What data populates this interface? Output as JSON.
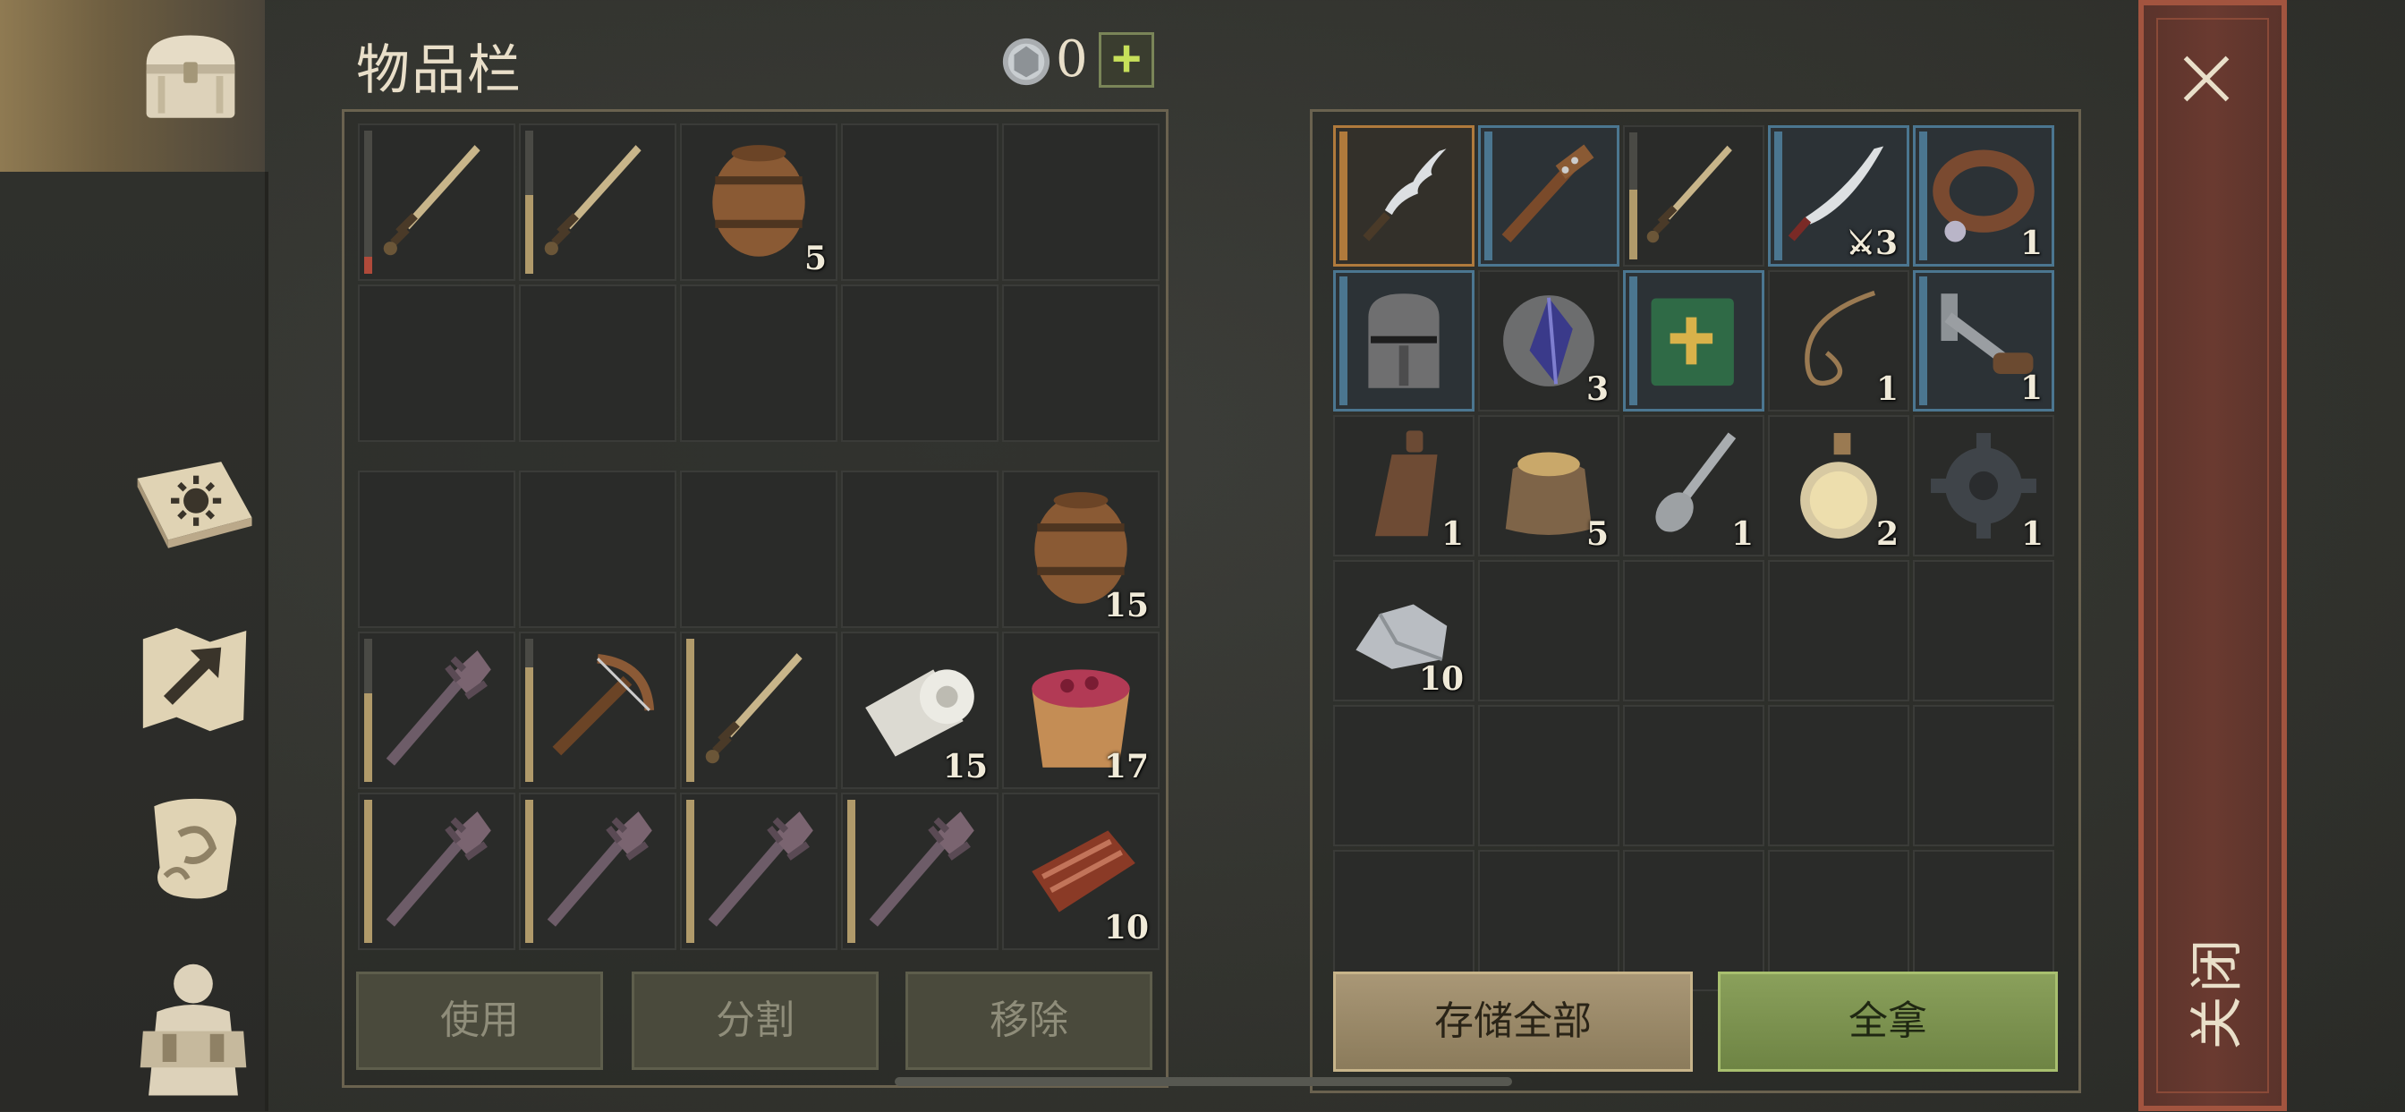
{
  "header": {
    "title": "物品栏",
    "coin_count": "0",
    "add_label": "+"
  },
  "sidebar": {
    "items": [
      {
        "name": "storage-chest",
        "active": true
      },
      {
        "name": "crafting-book",
        "active": false
      },
      {
        "name": "map",
        "active": false
      },
      {
        "name": "quest-scroll",
        "active": false
      },
      {
        "name": "character-equipment",
        "active": false
      }
    ]
  },
  "inventory": {
    "top_grid": [
      {
        "icon": "sword-icon",
        "count": "",
        "durability": 0.12,
        "dur_color": "#b04a3a"
      },
      {
        "icon": "sword-icon",
        "count": "",
        "durability": 0.55,
        "dur_color": "#b09a6a"
      },
      {
        "icon": "barrel-icon",
        "count": "5"
      },
      null,
      null,
      null,
      null,
      null,
      null,
      null
    ],
    "bottom_grid": [
      null,
      null,
      null,
      null,
      {
        "icon": "barrel-icon",
        "count": "15"
      },
      {
        "icon": "mace-icon",
        "count": "",
        "durability": 0.62,
        "dur_color": "#b09a6a"
      },
      {
        "icon": "crossbow-icon",
        "count": "",
        "durability": 0.8,
        "dur_color": "#b09a6a"
      },
      {
        "icon": "sword-icon",
        "count": "",
        "durability": 1.0,
        "dur_color": "#b09a6a"
      },
      {
        "icon": "cloth-roll-icon",
        "count": "15"
      },
      {
        "icon": "berry-bucket-icon",
        "count": "17"
      },
      {
        "icon": "mace-icon",
        "count": "",
        "durability": 1.0,
        "dur_color": "#b09a6a"
      },
      {
        "icon": "mace-icon",
        "count": "",
        "durability": 1.0,
        "dur_color": "#b09a6a"
      },
      {
        "icon": "mace-icon",
        "count": "",
        "durability": 1.0,
        "dur_color": "#b09a6a"
      },
      {
        "icon": "mace-icon",
        "count": "",
        "durability": 1.0,
        "dur_color": "#b09a6a"
      },
      {
        "icon": "meat-icon",
        "count": "10"
      }
    ],
    "buttons": {
      "use": "使用",
      "split": "分割",
      "remove": "移除"
    }
  },
  "container": {
    "grid": [
      {
        "icon": "kris-dagger-icon",
        "count": "",
        "rarity": "orange"
      },
      {
        "icon": "spiked-club-icon",
        "count": "",
        "rarity": "blue"
      },
      {
        "icon": "sword-icon",
        "count": "",
        "durability": 0.55,
        "dur_color": "#b09a6a"
      },
      {
        "icon": "scimitar-icon",
        "count": "⚔3",
        "rarity": "blue"
      },
      {
        "icon": "collar-icon",
        "count": "1",
        "rarity": "blue"
      },
      {
        "icon": "great-helm-icon",
        "count": "",
        "rarity": "blue"
      },
      {
        "icon": "crystal-icon",
        "count": "3"
      },
      {
        "icon": "holy-book-icon",
        "count": "",
        "rarity": "blue"
      },
      {
        "icon": "rope-icon",
        "count": "1"
      },
      {
        "icon": "crank-icon",
        "count": "1",
        "rarity": "blue"
      },
      {
        "icon": "bottle-icon",
        "count": "1"
      },
      {
        "icon": "grain-sack-icon",
        "count": "5"
      },
      {
        "icon": "spoon-icon",
        "count": "1"
      },
      {
        "icon": "potion-icon",
        "count": "2"
      },
      {
        "icon": "gear-icon",
        "count": "1"
      },
      {
        "icon": "ore-icon",
        "count": "10"
      },
      null,
      null,
      null,
      null,
      null,
      null,
      null,
      null,
      null,
      null,
      null,
      null,
      null,
      null
    ],
    "buttons": {
      "store_all": "存储全部",
      "take_all": "全拿"
    }
  },
  "close": {
    "label": "关闭"
  },
  "colors": {
    "panel_border": "#6a624f",
    "rarity_orange": "#b07a3c",
    "rarity_blue": "#4b7690",
    "take_button": "#8aa05b",
    "close_panel": "#6a3a30"
  }
}
